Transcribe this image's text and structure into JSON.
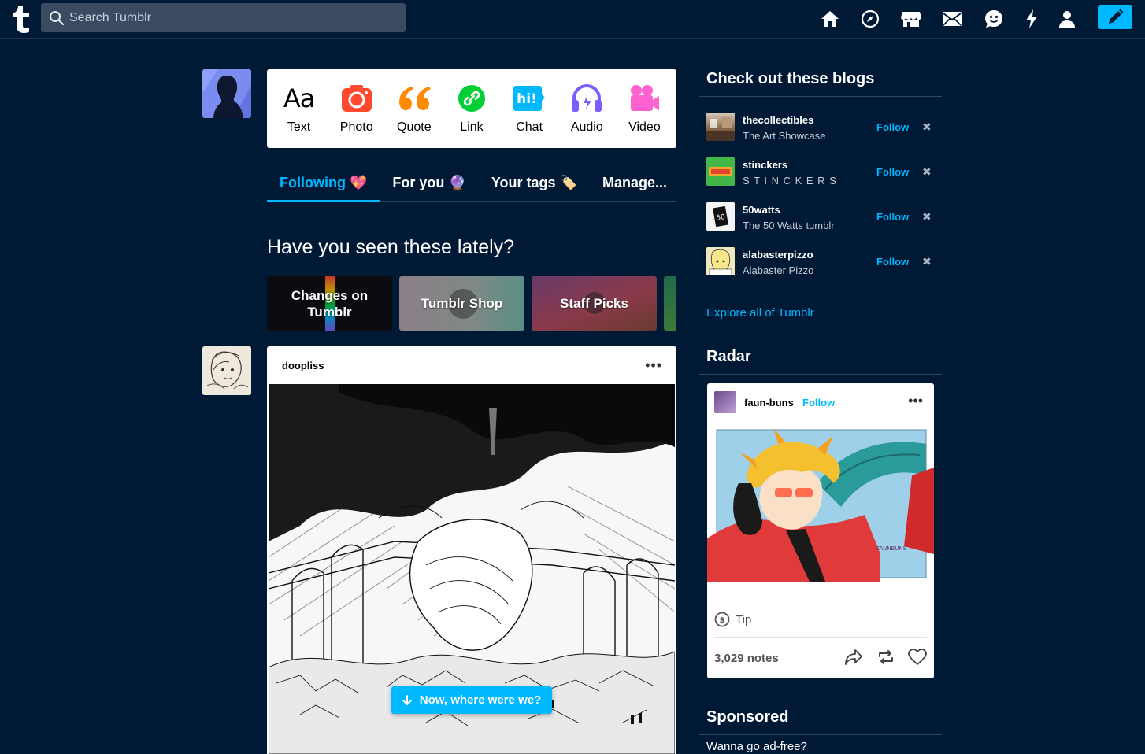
{
  "topbar": {
    "logo_letter": "t",
    "search_placeholder": "Search Tumblr",
    "nav_icons": [
      "home-icon",
      "explore-icon",
      "shop-icon",
      "inbox-icon",
      "messages-icon",
      "activity-icon",
      "account-icon"
    ],
    "compose_icon": "pencil-icon"
  },
  "composer": {
    "items": [
      {
        "label": "Text",
        "icon": "text-icon",
        "color": "#000000"
      },
      {
        "label": "Photo",
        "icon": "camera-icon",
        "color": "#ff4930"
      },
      {
        "label": "Quote",
        "icon": "quote-icon",
        "color": "#ff8a00"
      },
      {
        "label": "Link",
        "icon": "link-icon",
        "color": "#00cf35"
      },
      {
        "label": "Chat",
        "icon": "chat-icon",
        "color": "#00b8ff"
      },
      {
        "label": "Audio",
        "icon": "headphones-icon",
        "color": "#7c5cff"
      },
      {
        "label": "Video",
        "icon": "video-camera-icon",
        "color": "#ff62ce"
      }
    ]
  },
  "tabs": [
    {
      "label": "Following",
      "emoji": "💖",
      "active": true
    },
    {
      "label": "For you",
      "emoji": "🔮",
      "active": false
    },
    {
      "label": "Your tags",
      "emoji": "🏷️",
      "active": false
    },
    {
      "label": "Manage...",
      "emoji": "",
      "active": false
    }
  ],
  "lately": {
    "title": "Have you seen these lately?",
    "cards": [
      "Changes on Tumblr",
      "Tumblr Shop",
      "Staff Picks"
    ]
  },
  "post": {
    "blog_name": "doopliss",
    "more": "•••"
  },
  "toast": {
    "label": "Now, where were we?",
    "icon": "arrow-down-icon"
  },
  "sidebar": {
    "blogs_heading": "Check out these blogs",
    "blogs": [
      {
        "name": "thecollectibles",
        "title": "The Art Showcase",
        "follow": "Follow"
      },
      {
        "name": "stinckers",
        "title": "S T I N C K E R S",
        "follow": "Follow"
      },
      {
        "name": "50watts",
        "title": "The 50 Watts tumblr",
        "follow": "Follow"
      },
      {
        "name": "alabasterpizzo",
        "title": "Alabaster Pizzo",
        "follow": "Follow"
      }
    ],
    "explore_link": "Explore all of Tumblr",
    "radar_heading": "Radar",
    "radar": {
      "blog_name": "faun-buns",
      "follow": "Follow",
      "more": "•••",
      "tip": "Tip",
      "notes": "3,029 notes",
      "signature": "FAUNBUNS"
    },
    "sponsored_heading": "Sponsored",
    "ad_free_text": "Wanna go ad-free?"
  },
  "colors": {
    "background": "#001935",
    "accent": "#00b8ff",
    "search_bg": "#3a4b61"
  }
}
